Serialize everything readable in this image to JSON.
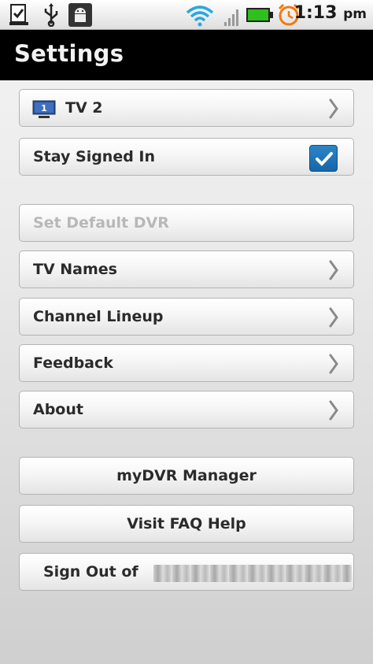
{
  "status_bar": {
    "time": "1:13",
    "time_suffix": "pm",
    "icons": [
      "notification-check-icon",
      "usb-icon",
      "android-debug-icon",
      "wifi-icon",
      "signal-icon",
      "battery-icon",
      "alarm-icon"
    ],
    "battery_color": "#2fbf1e",
    "alarm_color": "#f07a10"
  },
  "title_bar": {
    "title": "Settings"
  },
  "settings": {
    "tv": {
      "label": "TV 2",
      "icon_number": "1"
    },
    "stay_signed_in": {
      "label": "Stay Signed In",
      "checked": true
    },
    "set_default_dvr": {
      "label": "Set Default DVR",
      "enabled": false
    },
    "tv_names": {
      "label": "TV Names"
    },
    "channel_lineup": {
      "label": "Channel Lineup"
    },
    "feedback": {
      "label": "Feedback"
    },
    "about": {
      "label": "About"
    }
  },
  "actions": {
    "mydvr_manager": {
      "label": "myDVR Manager"
    },
    "visit_faq": {
      "label": "Visit FAQ Help"
    },
    "sign_out": {
      "label": "Sign Out of"
    }
  },
  "colors": {
    "accent": "#1f74b8",
    "title_bg": "#000000",
    "disabled_text": "#b8b8b8"
  }
}
